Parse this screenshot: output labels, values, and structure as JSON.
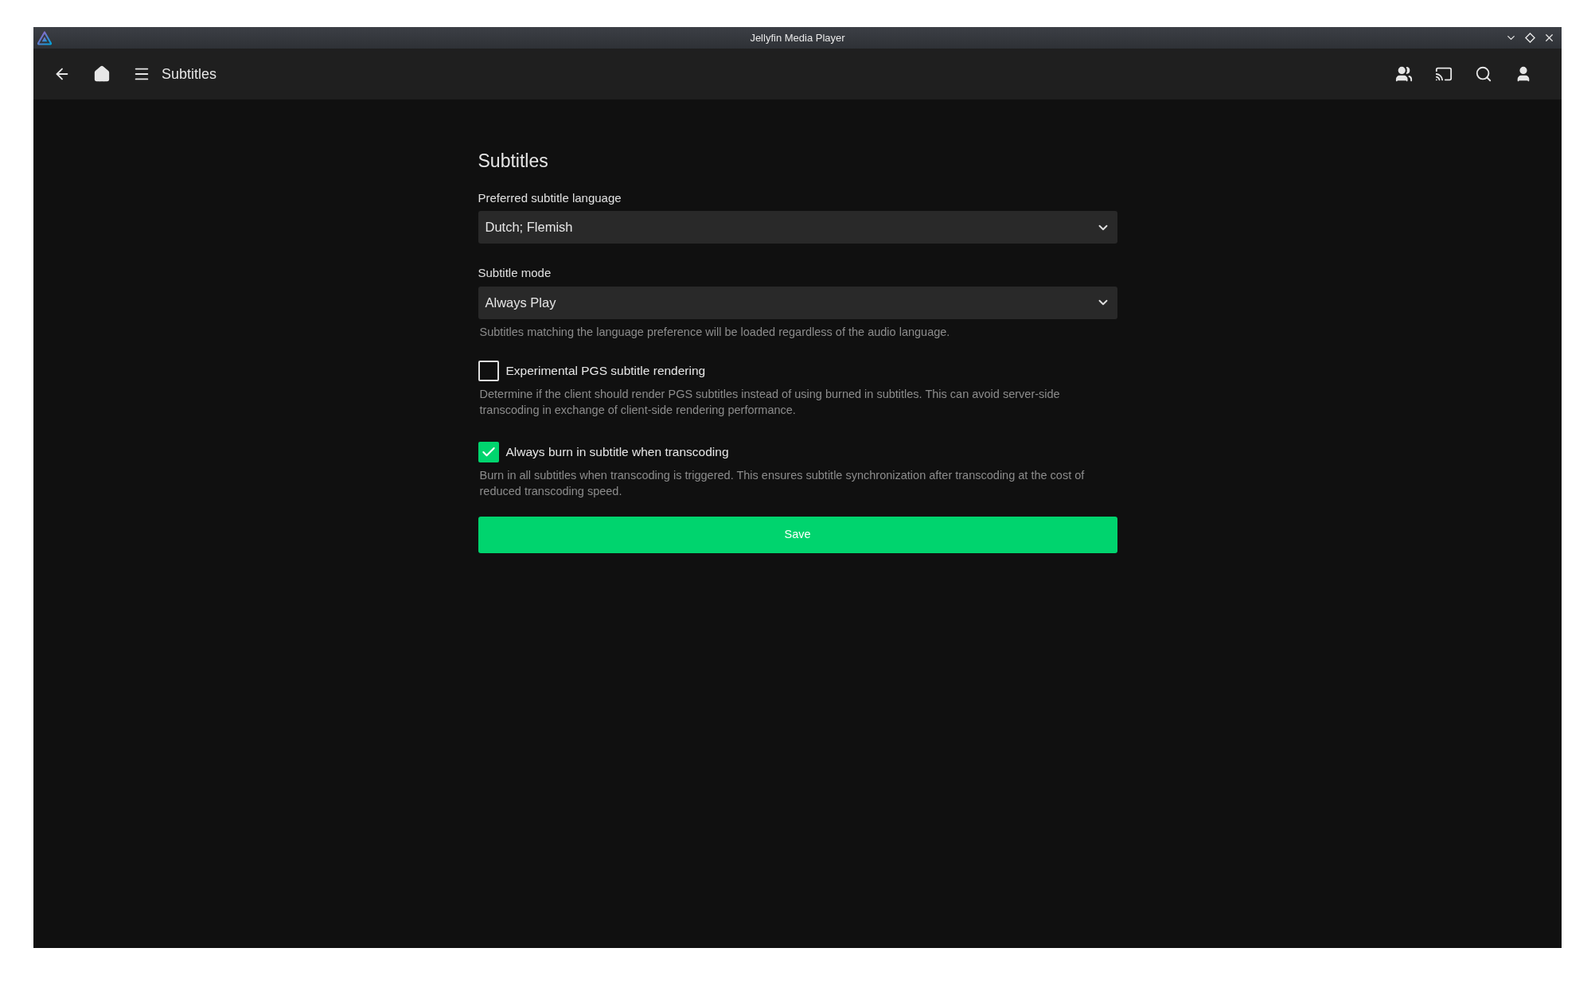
{
  "window": {
    "title": "Jellyfin Media Player"
  },
  "header": {
    "title": "Subtitles"
  },
  "page": {
    "heading": "Subtitles",
    "settings": [
      {
        "kind": "select",
        "label": "Preferred subtitle language",
        "value": "Dutch; Flemish"
      },
      {
        "kind": "select",
        "label": "Subtitle mode",
        "value": "Always Play",
        "help": "Subtitles matching the language preference will be loaded regardless of the audio language."
      },
      {
        "kind": "checkbox",
        "label": "Experimental PGS subtitle rendering",
        "checked": false,
        "help": "Determine if the client should render PGS subtitles instead of using burned in subtitles. This can avoid server-side transcoding in exchange of client-side rendering performance."
      },
      {
        "kind": "checkbox",
        "label": "Always burn in subtitle when transcoding",
        "checked": true,
        "help": "Burn in all subtitles when transcoding is triggered. This ensures subtitle synchronization after transcoding at the cost of reduced transcoding speed."
      }
    ],
    "save": "Save"
  }
}
